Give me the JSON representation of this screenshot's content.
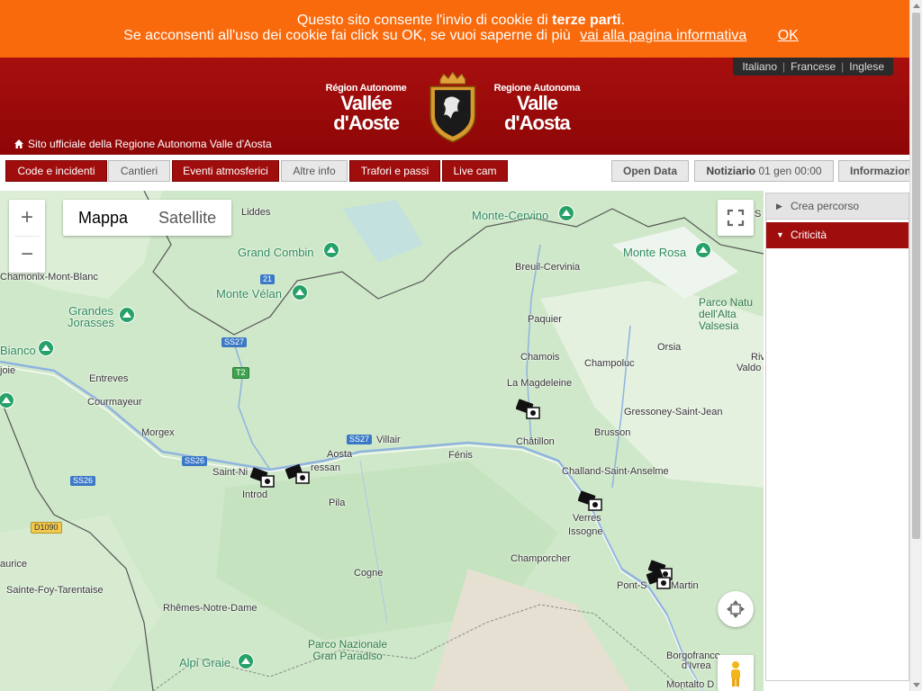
{
  "cookie": {
    "line1_pre": "Questo sito consente l'invio di cookie di ",
    "line1_bold": "terze parti",
    "line1_post": ".",
    "line2": "Se acconsenti all'uso dei cookie fai click su OK, se vuoi saperne di più",
    "info_link": "vai alla pagina informativa",
    "ok": "OK"
  },
  "header": {
    "languages": [
      "Italiano",
      "Francese",
      "Inglese"
    ],
    "brand_fr_small": "Région Autonome",
    "brand_fr_big": "Vallée d'Aoste",
    "brand_it_small": "Regione Autonoma",
    "brand_it_big": "Valle d'Aosta",
    "official_site": "Sito ufficiale della Regione Autonoma Valle d'Aosta"
  },
  "toolbar": {
    "tabs": [
      "Code e incidenti",
      "Cantieri",
      "Eventi atmosferici",
      "Altre info",
      "Trafori e passi",
      "Live cam"
    ],
    "open_data": "Open Data",
    "notiziario_label": "Notiziario",
    "notiziario_date": "01 gen 00:00",
    "informazioni": "Informazioni"
  },
  "map": {
    "type_map": "Mappa",
    "type_satellite": "Satellite",
    "zoom_in": "+",
    "zoom_out": "−",
    "towns": [
      "Liddes",
      "Chamonix-Mont-Blanc",
      "Entreves",
      "Courmayeur",
      "Morgex",
      "Saint-Ni",
      "Introd",
      "ressan",
      "Aosta",
      "Villair",
      "Fénis",
      "Pila",
      "Cogne",
      "Rhêmes-Notre-Dame",
      "Sainte-Foy-Tarentaise",
      "aurice",
      "Breuil-Cervinia",
      "Paquier",
      "Chamois",
      "Champoluc",
      "La Magdeleine",
      "Châtillon",
      "Brusson",
      "Gressoney-Saint-Jean",
      "Challand-Saint-Anselme",
      "Verres",
      "Issogne",
      "Champorcher",
      "Pont-S",
      "Martin",
      "Borgofranco",
      "d'Ivrea",
      "Montalto D",
      "Orsia",
      "Riv",
      "Valdo",
      "joie",
      "Bianco",
      "S"
    ],
    "peaks": [
      "Monte-Cervino",
      "Grand Combin",
      "Monte Vélan",
      "Grandes Jorasses",
      "Monte Rosa",
      "Alpi Graie"
    ],
    "parks": [
      "Parco Nazionale Gran Paradiso",
      "Parco Natu dell'Alta Valsesia"
    ],
    "roads": [
      "21",
      "SS27",
      "T2",
      "SS27",
      "SS26",
      "SS26",
      "D1090"
    ]
  },
  "panel": {
    "crea_percorso": "Crea percorso",
    "criticita": "Criticità"
  },
  "colors": {
    "cookie_bg": "#f96a0c",
    "header_red": "#a80f0f",
    "button_red": "#a00d0d",
    "map_green": "#cfe8c9"
  }
}
